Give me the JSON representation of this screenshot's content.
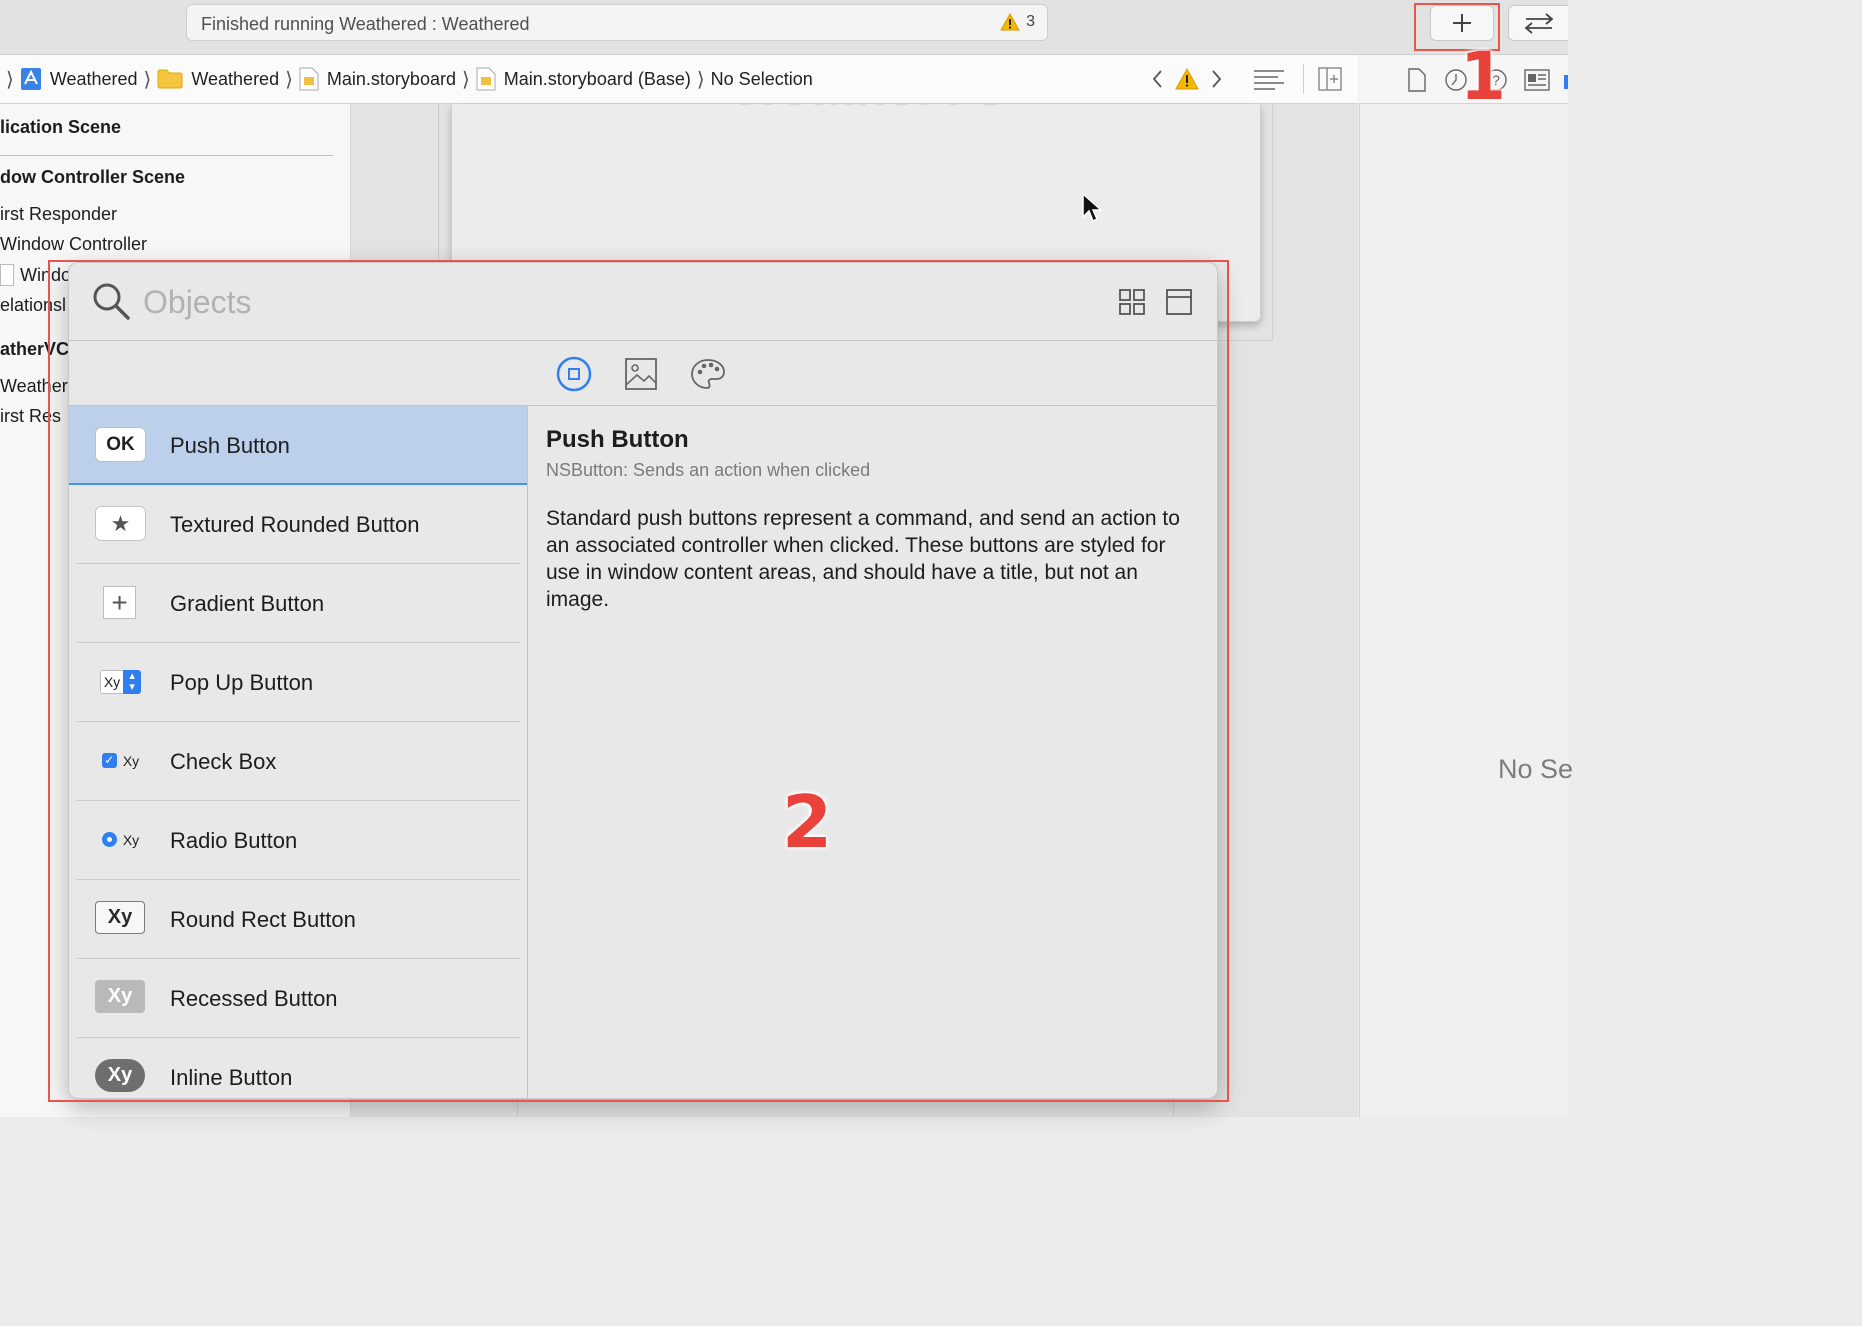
{
  "toolbar": {
    "activity_text": "Finished running Weathered : Weathered",
    "warning_count": "3",
    "add_icon": "plus-icon",
    "swap_icon": "swap-arrows-icon"
  },
  "jumpbar": {
    "crumbs": [
      {
        "label": "Weathered",
        "icon": "project-icon"
      },
      {
        "label": "Weathered",
        "icon": "folder-icon"
      },
      {
        "label": "Main.storyboard",
        "icon": "storyboard-file-icon"
      },
      {
        "label": "Main.storyboard (Base)",
        "icon": "storyboard-file-icon"
      },
      {
        "label": "No Selection",
        "icon": ""
      }
    ]
  },
  "outline": {
    "items": [
      {
        "label": "lication Scene"
      },
      {
        "label": "dow Controller Scene"
      },
      {
        "label": "irst Responder"
      },
      {
        "label": "Window Controller"
      },
      {
        "label": "Windo"
      },
      {
        "label": "elationsl"
      },
      {
        "label": "atherVC"
      },
      {
        "label": "Weather\\"
      },
      {
        "label": "irst Res"
      }
    ]
  },
  "canvas": {
    "scene_title": "WeatherVC"
  },
  "inspector": {
    "empty_text": "No Se"
  },
  "library": {
    "search_placeholder": "Objects",
    "tabs": [
      "objects-tab-icon",
      "media-tab-icon",
      "colors-tab-icon"
    ],
    "items": [
      {
        "label": "Push Button",
        "icon_text": "OK",
        "selected": true
      },
      {
        "label": "Textured Rounded Button",
        "icon_text": "★"
      },
      {
        "label": "Gradient Button",
        "icon_text": "+"
      },
      {
        "label": "Pop Up Button",
        "icon_text": "Xy"
      },
      {
        "label": "Check Box",
        "icon_text": "Xy"
      },
      {
        "label": "Radio Button",
        "icon_text": "Xy"
      },
      {
        "label": "Round Rect Button",
        "icon_text": "Xy"
      },
      {
        "label": "Recessed Button",
        "icon_text": "Xy"
      },
      {
        "label": "Inline Button",
        "icon_text": "Xy"
      }
    ],
    "detail": {
      "title": "Push Button",
      "subtitle": "NSButton: Sends an action when clicked",
      "body": "Standard push buttons represent a command, and send an action to an associated controller when clicked. These buttons are styled for use in window content areas, and should have a title, but not an image."
    }
  },
  "annotations": {
    "first": "1",
    "second": "2"
  },
  "colors": {
    "annotation": "#e8554f",
    "selection": "#bcd0ec",
    "accent": "#2f7ff0",
    "warning": "#f5b800"
  }
}
